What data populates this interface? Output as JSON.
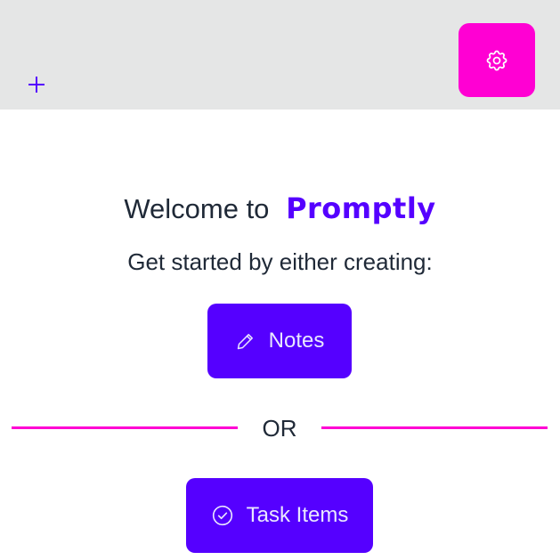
{
  "header": {
    "add_icon": "plus-icon",
    "settings_icon": "gear-icon",
    "settings_color": "#ff00d3"
  },
  "welcome": {
    "prefix": "Welcome to",
    "brand": "Promptly",
    "subtitle": "Get started by either creating:"
  },
  "actions": {
    "notes_label": "Notes",
    "notes_icon": "pencil-icon",
    "separator": "OR",
    "tasks_label": "Task Items",
    "tasks_icon": "check-circle-icon"
  },
  "colors": {
    "accent": "#5500ff",
    "secondary": "#ff00d3",
    "header_bg": "#e5e6e6",
    "text": "#1f2937"
  }
}
